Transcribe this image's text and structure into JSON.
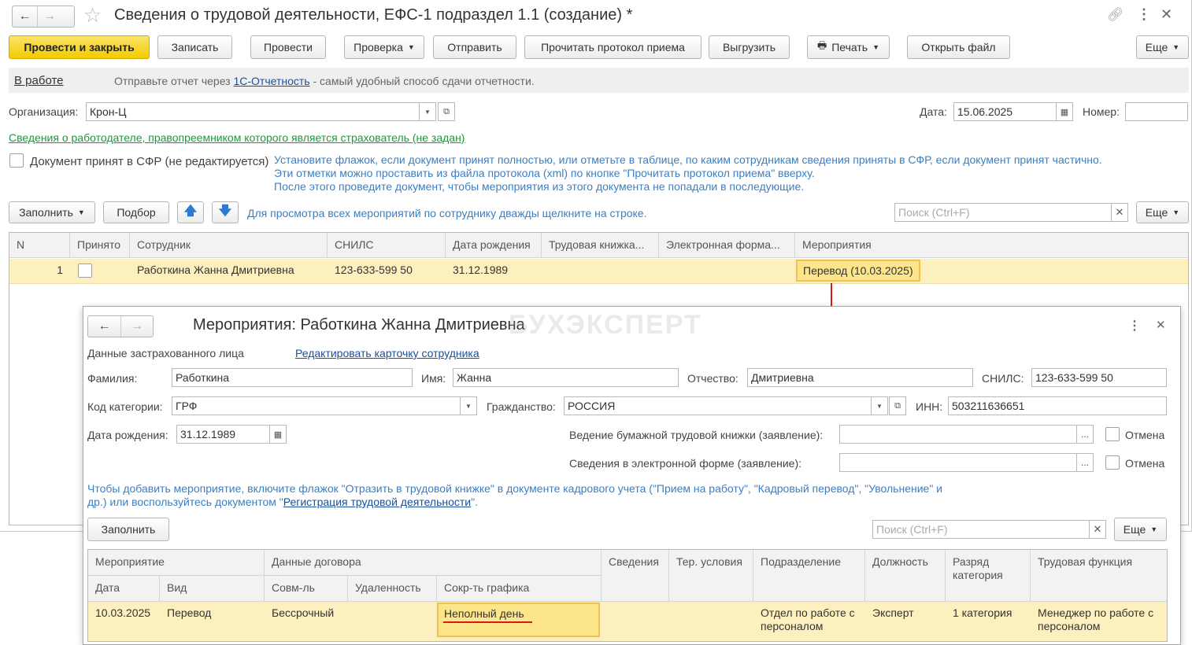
{
  "main": {
    "title": "Сведения о трудовой деятельности, ЕФС-1 подраздел 1.1 (создание) *",
    "toolbar": {
      "post_close": "Провести и закрыть",
      "write": "Записать",
      "post": "Провести",
      "check": "Проверка",
      "send": "Отправить",
      "read_protocol": "Прочитать протокол приема",
      "export": "Выгрузить",
      "print": "Печать",
      "open_file": "Открыть файл",
      "more": "Еще"
    },
    "status": {
      "state": "В работе",
      "msg_before": "Отправьте отчет через ",
      "msg_link": "1С-Отчетность",
      "msg_after": " - самый удобный способ сдачи отчетности."
    },
    "org_label": "Организация:",
    "org_value": "Крон-Ц",
    "date_label": "Дата:",
    "date_value": "15.06.2025",
    "number_label": "Номер:",
    "number_value": "",
    "successor_link": "Сведения о работодателе, правопреемником которого является страхователь (не задан)",
    "accepted_label": "Документ принят в СФР (не редактируется)",
    "hint_lines": [
      "Установите флажок, если документ принят полностью, или отметьте в таблице, по каким сотрудникам сведения приняты в СФР, если документ принят частично.",
      "Эти отметки можно проставить из файла протокола (xml) по кнопке \"Прочитать протокол приема\" вверху.",
      "После этого проведите документ, чтобы мероприятия из этого документа не попадали в последующие."
    ],
    "table_toolbar": {
      "fill": "Заполнить",
      "select": "Подбор",
      "hint": "Для просмотра всех мероприятий по сотруднику дважды щелкните на строке.",
      "search_placeholder": "Поиск (Ctrl+F)",
      "more": "Еще"
    },
    "columns": [
      "N",
      "Принято",
      "Сотрудник",
      "СНИЛС",
      "Дата рождения",
      "Трудовая книжка...",
      "Электронная форма...",
      "Мероприятия"
    ],
    "rows": [
      {
        "n": "1",
        "employee": "Работкина Жанна Дмитриевна",
        "snils": "123-633-599 50",
        "birth": "31.12.1989",
        "book": "",
        "eform": "",
        "events": "Перевод (10.03.2025)"
      }
    ]
  },
  "dialog": {
    "title": "Мероприятия: Работкина Жанна Дмитриевна",
    "watermark": "БУХЭКСПЕРТ",
    "insured_label": "Данные застрахованного лица",
    "edit_card_link": "Редактировать карточку сотрудника",
    "surname_label": "Фамилия:",
    "surname": "Работкина",
    "name_label": "Имя:",
    "name": "Жанна",
    "patronymic_label": "Отчество:",
    "patronymic": "Дмитриевна",
    "snils_label": "СНИЛС:",
    "snils": "123-633-599 50",
    "category_label": "Код категории:",
    "category": "ГРФ",
    "citizenship_label": "Гражданство:",
    "citizenship": "РОССИЯ",
    "inn_label": "ИНН:",
    "inn": "503211636651",
    "birth_label": "Дата рождения:",
    "birth": "31.12.1989",
    "paper_book_label": "Ведение бумажной трудовой книжки (заявление):",
    "eform_label": "Сведения в электронной форме (заявление):",
    "cancel_label": "Отмена",
    "dots": "...",
    "info_line1": "Чтобы добавить мероприятие, включите флажок \"Отразить в трудовой книжке\" в документе кадрового учета (\"Прием на работу\", \"Кадровый перевод\", \"Увольнение\" и",
    "info_line2_before": "др.) или воспользуйтесь документом \"",
    "info_link": "Регистрация трудовой деятельности",
    "info_line2_after": "\".",
    "fill": "Заполнить",
    "search_placeholder": "Поиск (Ctrl+F)",
    "more": "Еще",
    "headers": {
      "event": "Мероприятие",
      "contract": "Данные договора",
      "info": "Сведения",
      "ter": "Тер. условия",
      "dept": "Подразделение",
      "position": "Должность",
      "grade": "Разряд категория",
      "function": "Трудовая функция",
      "date": "Дата",
      "kind": "Вид",
      "combo": "Совм-ль",
      "remote": "Удаленность",
      "reduced": "Сокр-ть графика"
    },
    "row": {
      "date": "10.03.2025",
      "kind": "Перевод",
      "combo": "Бессрочный",
      "remote": "",
      "reduced": "Неполный день",
      "info": "",
      "ter": "",
      "dept": "Отдел по работе с персоналом",
      "position": "Эксперт",
      "grade": "1 категория",
      "function": "Менеджер по работе с персоналом"
    }
  }
}
